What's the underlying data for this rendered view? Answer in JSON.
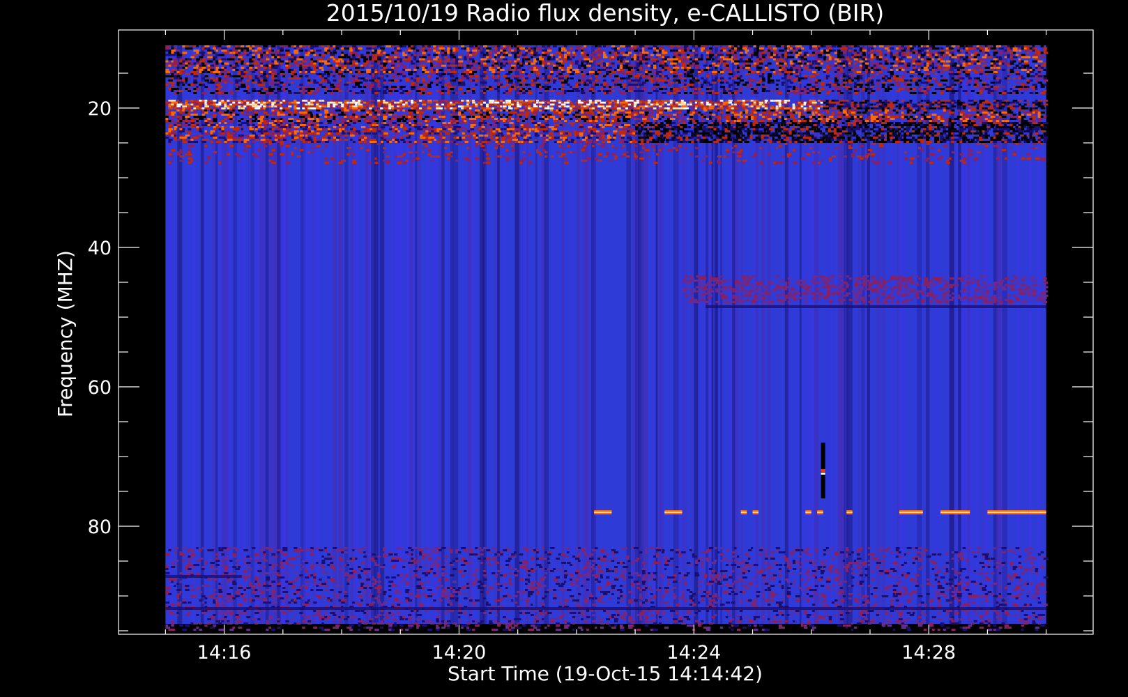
{
  "chart_data": {
    "type": "heatmap",
    "title": "2015/10/19  Radio flux density, e-CALLISTO (BIR)",
    "xlabel": "Start Time (19-Oct-15 14:14:42)",
    "ylabel": "Frequency (MHZ)",
    "x_unit": "minutes after 14:00",
    "xlim": [
      14.2,
      30.8
    ],
    "ylim": [
      95.5,
      8.8
    ],
    "y_inverted": true,
    "data_extent": {
      "x": [
        15.0,
        30.0
      ],
      "y": [
        11,
        94
      ]
    },
    "x_major_ticks": [
      16,
      20,
      24,
      28
    ],
    "x_tick_labels": [
      "14:16",
      "14:20",
      "14:24",
      "14:28"
    ],
    "y_major_ticks": [
      20,
      40,
      60,
      80
    ],
    "y_tick_labels": [
      "20",
      "40",
      "60",
      "80"
    ],
    "grid": false,
    "colormap": [
      "#000000",
      "#1a0f70",
      "#2f3bd6",
      "#3b34e8",
      "#8a2060",
      "#c0280e",
      "#ff6a00",
      "#ffe0a0",
      "#ffffff"
    ],
    "background": "#2f3bd6",
    "features": [
      {
        "name": "rfi-band-top",
        "freq_range": [
          11,
          15
        ],
        "intensity": "high"
      },
      {
        "name": "rfi-band-bright",
        "freq": 19.5,
        "x_range": [
          15.0,
          26.0
        ],
        "intensity": "very-high"
      },
      {
        "name": "rfi-band-dark",
        "freq_range": [
          22,
          25
        ],
        "x_range": [
          23.0,
          30.0
        ],
        "intensity": "low"
      },
      {
        "name": "interference-line",
        "freq": 78,
        "x_range": [
          22.3,
          30.0
        ],
        "intensity": "high"
      },
      {
        "name": "glitch",
        "x": 26.2,
        "freq_range": [
          68,
          76
        ],
        "intensity": "very-high"
      }
    ]
  }
}
